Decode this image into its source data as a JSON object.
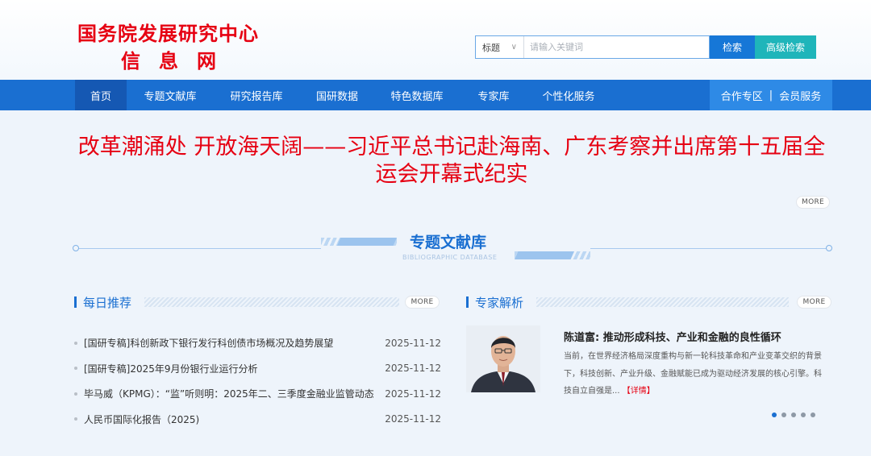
{
  "site": {
    "name_line1": "国务院发展研究中心",
    "name_line2": "信息网"
  },
  "search": {
    "type_label": "标题",
    "placeholder": "请输入关键词",
    "search_label": "检索",
    "advanced_label": "高级检索"
  },
  "nav": {
    "items": [
      "首页",
      "专题文献库",
      "研究报告库",
      "国研数据",
      "特色数据库",
      "专家库",
      "个性化服务"
    ],
    "active_index": 0,
    "right_left": "合作专区",
    "right_sep": "|",
    "right_right": "会员服务"
  },
  "headline": {
    "text": "改革潮涌处 开放海天阔——习近平总书记赴海南、广东考察并出席第十五届全运会开幕式纪实",
    "more": "MORE"
  },
  "section": {
    "title": "专题文献库",
    "subtitle": "BIBLIOGRAPHIC DATABASE"
  },
  "daily": {
    "title": "每日推荐",
    "more": "MORE",
    "items": [
      {
        "title": "[国研专稿]科创新政下银行发行科创债市场概况及趋势展望",
        "date": "2025-11-12"
      },
      {
        "title": "[国研专稿]2025年9月份银行业运行分析",
        "date": "2025-11-12"
      },
      {
        "title": "毕马威（KPMG）：“监”听则明：2025年二、三季度金融业监管动态",
        "date": "2025-11-12"
      },
      {
        "title": "人民币国际化报告（2025)",
        "date": "2025-11-12"
      }
    ]
  },
  "expert": {
    "title": "专家解析",
    "more": "MORE",
    "article_title": "陈道富: 推动形成科技、产业和金融的良性循环",
    "article_desc": "当前，在世界经济格局深度重构与新一轮科技革命和产业变革交织的背景下，科技创新、产业升级、金融赋能已成为驱动经济发展的核心引擎。科技自立自强是...",
    "detail_label": "【详情】",
    "carousel_active": 0
  },
  "colors": {
    "brand_red": "#e60012",
    "nav_blue": "#1a6fd1",
    "accent_teal": "#1fb5ba"
  }
}
